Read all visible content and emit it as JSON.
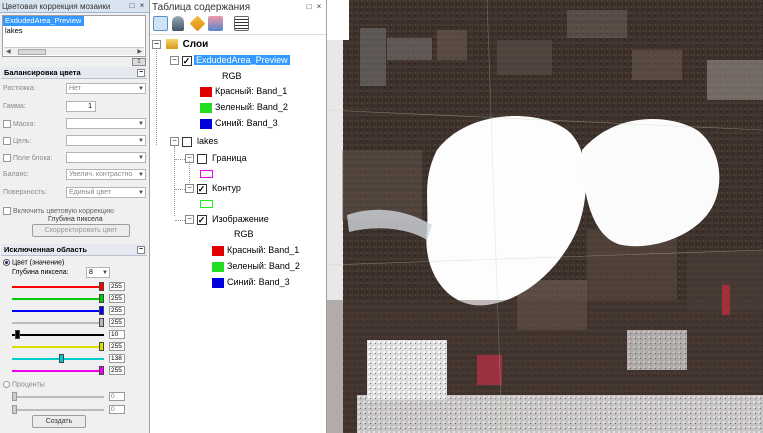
{
  "left_panel": {
    "title": "Цветовая коррекция мозаики",
    "datasets": [
      "ExdudedArea_Preview",
      "lakes"
    ],
    "balance": {
      "header": "Балансировка цвета",
      "stretch_label": "Растяжка:",
      "stretch_value": "Нет",
      "gamma_label": "Гамма:",
      "gamma_value": "1",
      "mask_label": "Маска:",
      "target_label": "Цель:",
      "block_field_label": "Поле блока:",
      "balance_label": "Баланс:",
      "balance_value": "Увелич. контрастно",
      "surface_label": "Поверхность:",
      "surface_value": "Единый цвет",
      "enable_label": "Включить цветовую коррекцию",
      "depth_label": "Глубина пиксела",
      "correct_button": "Скорректировать цвет"
    },
    "excluded": {
      "header": "Исключенная область",
      "color_radio": "Цвет (значение)",
      "depth_label": "Глубина пиксела:",
      "depth_value": "8",
      "sliders": [
        {
          "color": "#ff0000",
          "value": "255",
          "fraction": 1.0
        },
        {
          "color": "#00cc00",
          "value": "255",
          "fraction": 1.0
        },
        {
          "color": "#0000ff",
          "value": "255",
          "fraction": 1.0
        },
        {
          "color": "#bbbbbb",
          "value": "255",
          "fraction": 1.0
        },
        {
          "color": "#000000",
          "value": "10",
          "fraction": 0.04
        },
        {
          "color": "#dddd00",
          "value": "255",
          "fraction": 1.0
        },
        {
          "color": "#00cccc",
          "value": "138",
          "fraction": 0.54
        },
        {
          "color": "#ee00ee",
          "value": "255",
          "fraction": 1.0
        }
      ],
      "percent_radio": "Проценты",
      "percent_values": [
        "0",
        "0"
      ],
      "create_button": "Создать"
    }
  },
  "toc": {
    "title": "Таблица содержания",
    "root": "Слои",
    "layer1": {
      "name": "ExdudedArea_Preview",
      "subtitle": "RGB",
      "bands": [
        {
          "label": "Красный:",
          "band": "Band_1",
          "color": "#e00000"
        },
        {
          "label": "Зеленый:",
          "band": "Band_2",
          "color": "#22dd22"
        },
        {
          "label": "Синий:",
          "band": "Band_3",
          "color": "#0000dd"
        }
      ]
    },
    "layer2": {
      "name": "lakes",
      "boundary": "Граница",
      "boundary_color": "#ee00ee",
      "contour": "Контур",
      "contour_color": "#22ee22",
      "image": "Изображение",
      "image_subtitle": "RGB",
      "bands": [
        {
          "label": "Красный:",
          "band": "Band_1",
          "color": "#e00000"
        },
        {
          "label": "Зеленый:",
          "band": "Band_2",
          "color": "#22dd22"
        },
        {
          "label": "Синий:",
          "band": "Band_3",
          "color": "#0000dd"
        }
      ]
    }
  }
}
